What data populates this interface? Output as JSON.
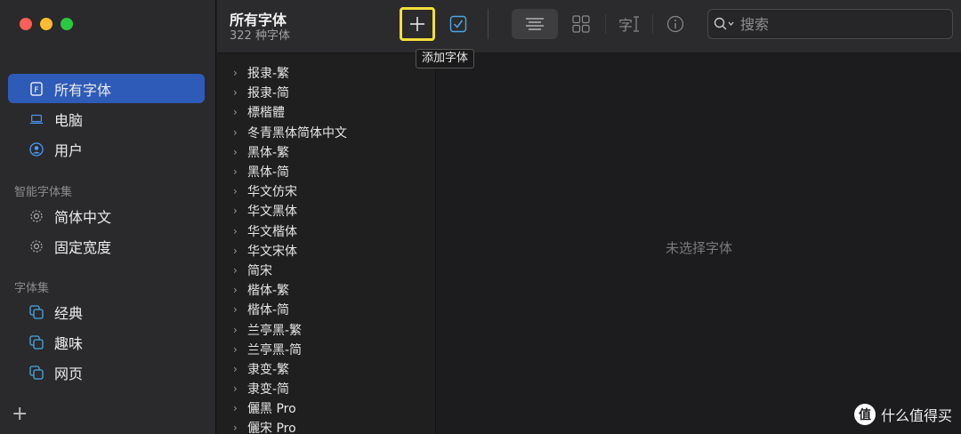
{
  "sidebar": {
    "items": [
      {
        "label": "所有字体",
        "icon": "font-file-icon"
      },
      {
        "label": "电脑",
        "icon": "laptop-icon"
      },
      {
        "label": "用户",
        "icon": "user-icon"
      }
    ],
    "smart_section": "智能字体集",
    "smart_items": [
      {
        "label": "简体中文",
        "icon": "gear-icon"
      },
      {
        "label": "固定宽度",
        "icon": "gear-icon"
      }
    ],
    "collections_section": "字体集",
    "collections": [
      {
        "label": "经典",
        "icon": "collection-icon"
      },
      {
        "label": "趣味",
        "icon": "collection-icon"
      },
      {
        "label": "网页",
        "icon": "collection-icon"
      }
    ],
    "add_label": "+"
  },
  "toolbar": {
    "title": "所有字体",
    "subtitle": "322 种字体",
    "add_tooltip": "添加字体",
    "search_placeholder": "搜索",
    "glyph_label": "字"
  },
  "fonts": [
    "报隶-繁",
    "报隶-简",
    "標楷體",
    "冬青黑体简体中文",
    "黑体-繁",
    "黑体-简",
    "华文仿宋",
    "华文黑体",
    "华文楷体",
    "华文宋体",
    "简宋",
    "楷体-繁",
    "楷体-简",
    "兰亭黑-繁",
    "兰亭黑-简",
    "隶变-繁",
    "隶变-简",
    "儷黑 Pro",
    "儷宋 Pro"
  ],
  "preview": {
    "empty_text": "未选择字体"
  },
  "watermark": {
    "logo_text": "值",
    "text": "什么值得买"
  },
  "colors": {
    "accent": "#2f5bb8",
    "highlight": "#f2de3b"
  }
}
